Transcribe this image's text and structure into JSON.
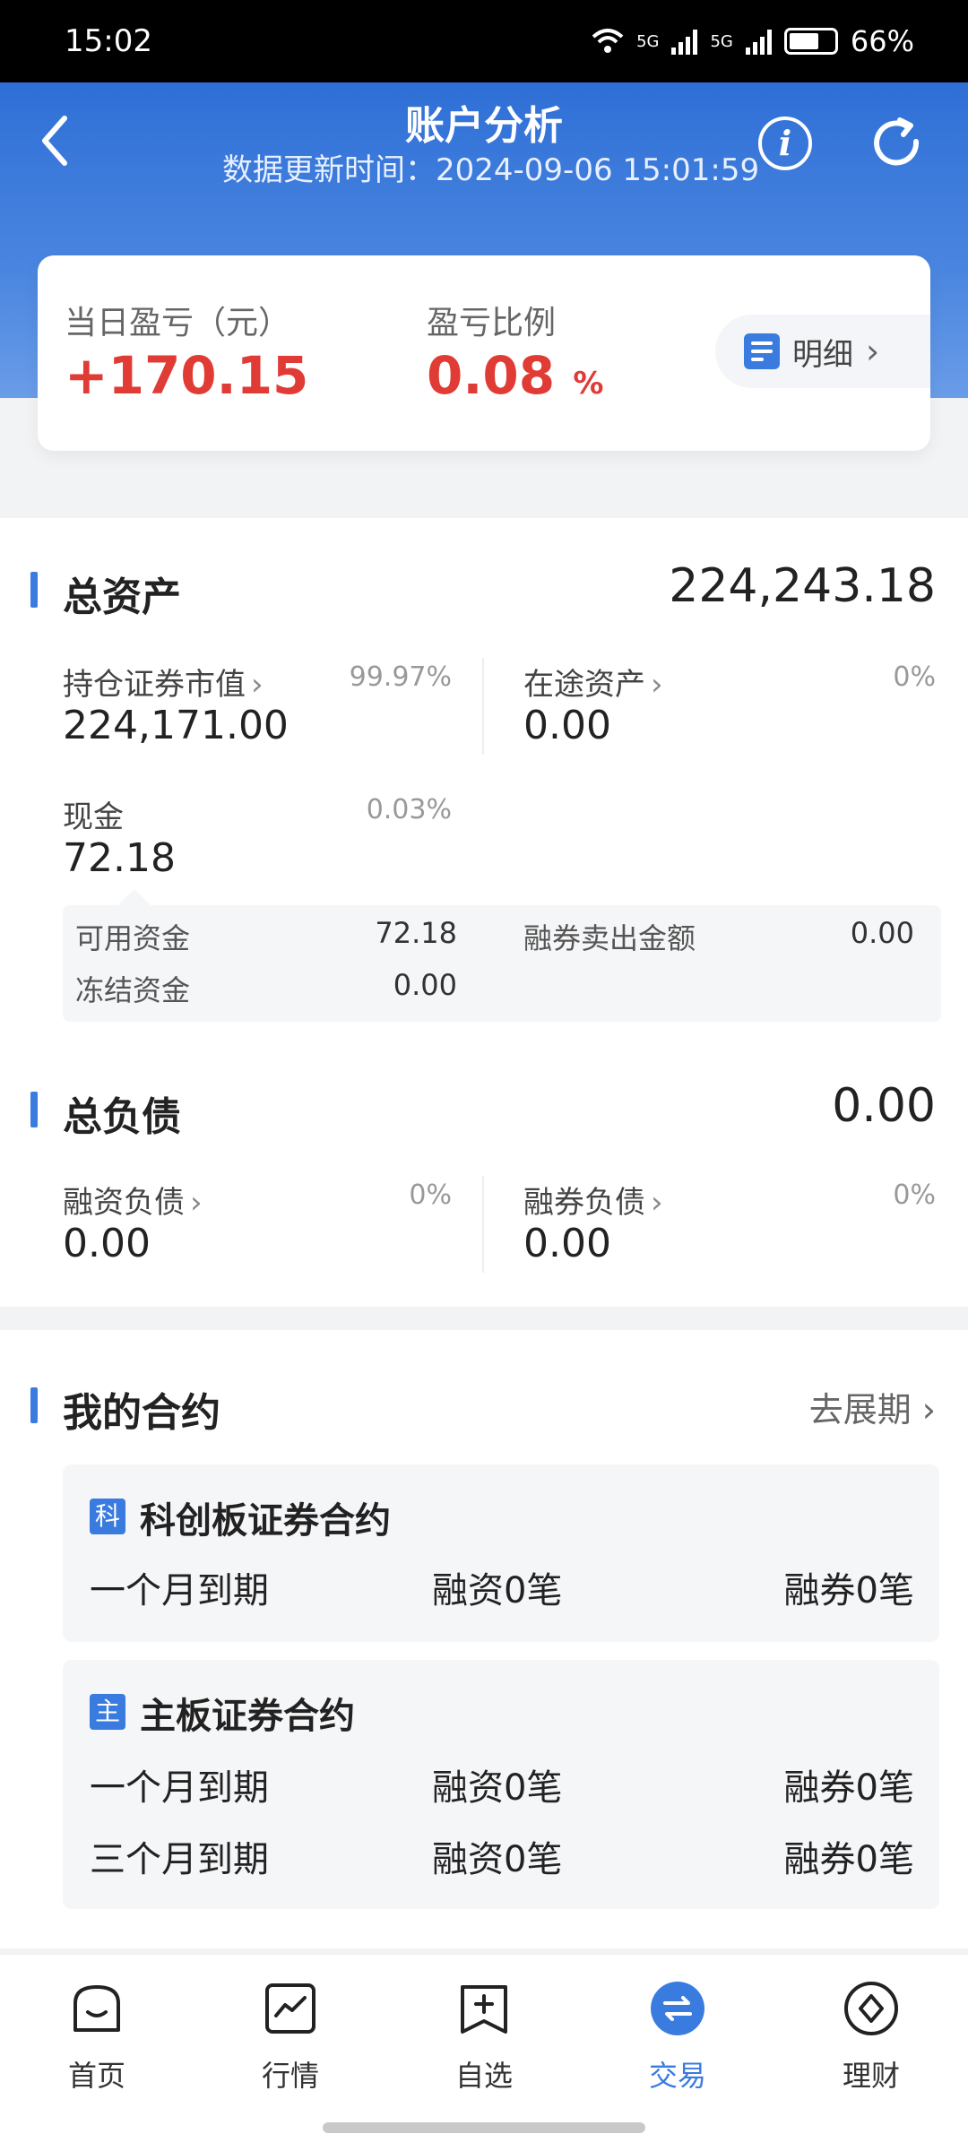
{
  "status": {
    "time": "15:02",
    "network1": "5G",
    "network2": "5G",
    "battery": "66%"
  },
  "header": {
    "title": "账户分析",
    "updated_label": "数据更新时间：",
    "updated_time": "2024-09-06 15:01:59"
  },
  "pnl": {
    "daily_label": "当日盈亏（元）",
    "daily_value": "+170.15",
    "ratio_label": "盈亏比例",
    "ratio_value": "0.08",
    "ratio_unit": "%",
    "detail_label": "明细"
  },
  "assets": {
    "title": "总资产",
    "total": "224,243.18",
    "holdings_label": "持仓证券市值",
    "holdings_pct": "99.97%",
    "holdings_value": "224,171.00",
    "transit_label": "在途资产",
    "transit_pct": "0%",
    "transit_value": "0.00",
    "cash_label": "现金",
    "cash_pct": "0.03%",
    "cash_value": "72.18",
    "available_label": "可用资金",
    "available_value": "72.18",
    "frozen_label": "冻结资金",
    "frozen_value": "0.00",
    "short_sale_label": "融券卖出金额",
    "short_sale_value": "0.00"
  },
  "liabilities": {
    "title": "总负债",
    "total": "0.00",
    "margin_label": "融资负债",
    "margin_pct": "0%",
    "margin_value": "0.00",
    "short_label": "融券负债",
    "short_pct": "0%",
    "short_value": "0.00"
  },
  "contracts": {
    "title": "我的合约",
    "extend_label": "去展期",
    "cards": [
      {
        "badge": "科",
        "title": "科创板证券合约",
        "rows": [
          {
            "term": "一个月到期",
            "financing": "融资0笔",
            "securities": "融券0笔"
          }
        ]
      },
      {
        "badge": "主",
        "title": "主板证券合约",
        "rows": [
          {
            "term": "一个月到期",
            "financing": "融资0笔",
            "securities": "融券0笔"
          },
          {
            "term": "三个月到期",
            "financing": "融资0笔",
            "securities": "融券0笔"
          }
        ]
      }
    ]
  },
  "nav": {
    "items": [
      {
        "label": "首页"
      },
      {
        "label": "行情"
      },
      {
        "label": "自选"
      },
      {
        "label": "交易"
      },
      {
        "label": "理财"
      }
    ],
    "active": "交易"
  },
  "colors": {
    "accent": "#3a7be0",
    "profit": "#e03b35",
    "header_top": "#2f6fd6"
  }
}
